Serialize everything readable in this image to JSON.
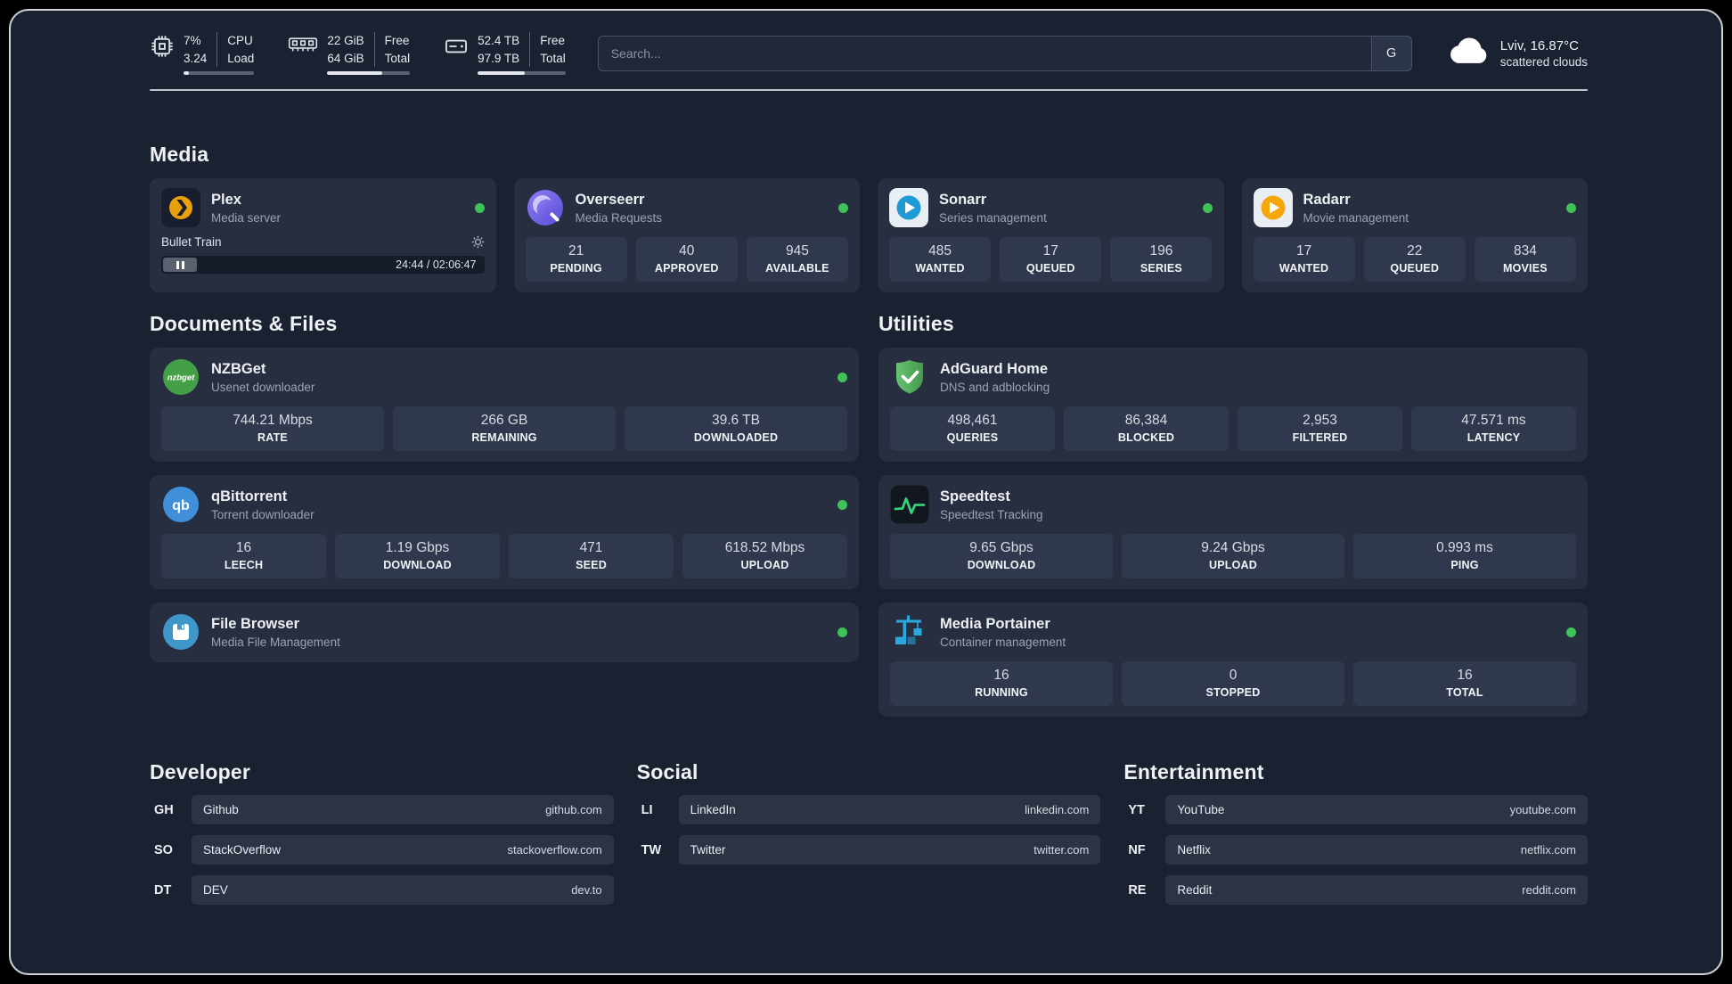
{
  "topbar": {
    "metrics": [
      {
        "name": "cpu",
        "values": [
          "7%",
          "3.24"
        ],
        "labels": [
          "CPU",
          "Load"
        ],
        "progress": 7
      },
      {
        "name": "ram",
        "values": [
          "22 GiB",
          "64 GiB"
        ],
        "labels": [
          "Free",
          "Total"
        ],
        "progress": 66
      },
      {
        "name": "disk",
        "values": [
          "52.4 TB",
          "97.9 TB"
        ],
        "labels": [
          "Free",
          "Total"
        ],
        "progress": 54
      }
    ],
    "search": {
      "placeholder": "Search...",
      "button_label": "G"
    },
    "weather": {
      "location": "Lviv, 16.87°C",
      "condition": "scattered clouds"
    }
  },
  "media": {
    "title": "Media",
    "plex": {
      "name": "Plex",
      "subtitle": "Media server",
      "now_playing": "Bullet Train",
      "time_display": "24:44 / 02:06:47"
    },
    "overseerr": {
      "name": "Overseerr",
      "subtitle": "Media Requests",
      "stats": [
        {
          "value": "21",
          "label": "PENDING"
        },
        {
          "value": "40",
          "label": "APPROVED"
        },
        {
          "value": "945",
          "label": "AVAILABLE"
        }
      ]
    },
    "sonarr": {
      "name": "Sonarr",
      "subtitle": "Series management",
      "stats": [
        {
          "value": "485",
          "label": "WANTED"
        },
        {
          "value": "17",
          "label": "QUEUED"
        },
        {
          "value": "196",
          "label": "SERIES"
        }
      ]
    },
    "radarr": {
      "name": "Radarr",
      "subtitle": "Movie management",
      "stats": [
        {
          "value": "17",
          "label": "WANTED"
        },
        {
          "value": "22",
          "label": "QUEUED"
        },
        {
          "value": "834",
          "label": "MOVIES"
        }
      ]
    }
  },
  "documents": {
    "title": "Documents & Files",
    "nzbget": {
      "name": "NZBGet",
      "subtitle": "Usenet downloader",
      "stats": [
        {
          "value": "744.21 Mbps",
          "label": "RATE"
        },
        {
          "value": "266 GB",
          "label": "REMAINING"
        },
        {
          "value": "39.6 TB",
          "label": "DOWNLOADED"
        }
      ]
    },
    "qbittorrent": {
      "name": "qBittorrent",
      "subtitle": "Torrent downloader",
      "stats": [
        {
          "value": "16",
          "label": "LEECH"
        },
        {
          "value": "1.19 Gbps",
          "label": "DOWNLOAD"
        },
        {
          "value": "471",
          "label": "SEED"
        },
        {
          "value": "618.52 Mbps",
          "label": "UPLOAD"
        }
      ]
    },
    "filebrowser": {
      "name": "File Browser",
      "subtitle": "Media File Management"
    }
  },
  "utilities": {
    "title": "Utilities",
    "adguard": {
      "name": "AdGuard Home",
      "subtitle": "DNS and adblocking",
      "stats": [
        {
          "value": "498,461",
          "label": "QUERIES"
        },
        {
          "value": "86,384",
          "label": "BLOCKED"
        },
        {
          "value": "2,953",
          "label": "FILTERED"
        },
        {
          "value": "47.571 ms",
          "label": "LATENCY"
        }
      ]
    },
    "speedtest": {
      "name": "Speedtest",
      "subtitle": "Speedtest Tracking",
      "stats": [
        {
          "value": "9.65 Gbps",
          "label": "DOWNLOAD"
        },
        {
          "value": "9.24 Gbps",
          "label": "UPLOAD"
        },
        {
          "value": "0.993 ms",
          "label": "PING"
        }
      ]
    },
    "portainer": {
      "name": "Media Portainer",
      "subtitle": "Container management",
      "stats": [
        {
          "value": "16",
          "label": "RUNNING"
        },
        {
          "value": "0",
          "label": "STOPPED"
        },
        {
          "value": "16",
          "label": "TOTAL"
        }
      ]
    }
  },
  "bookmarks": [
    {
      "title": "Developer",
      "items": [
        {
          "abbr": "GH",
          "name": "Github",
          "url": "github.com"
        },
        {
          "abbr": "SO",
          "name": "StackOverflow",
          "url": "stackoverflow.com"
        },
        {
          "abbr": "DT",
          "name": "DEV",
          "url": "dev.to"
        }
      ]
    },
    {
      "title": "Social",
      "items": [
        {
          "abbr": "LI",
          "name": "LinkedIn",
          "url": "linkedin.com"
        },
        {
          "abbr": "TW",
          "name": "Twitter",
          "url": "twitter.com"
        }
      ]
    },
    {
      "title": "Entertainment",
      "items": [
        {
          "abbr": "YT",
          "name": "YouTube",
          "url": "youtube.com"
        },
        {
          "abbr": "NF",
          "name": "Netflix",
          "url": "netflix.com"
        },
        {
          "abbr": "RE",
          "name": "Reddit",
          "url": "reddit.com"
        }
      ]
    }
  ],
  "colors": {
    "status_online": "#3fc258",
    "progress_fill": "#e3e6ed",
    "panel_background": "#1a2130",
    "card_background": "#262e40"
  }
}
